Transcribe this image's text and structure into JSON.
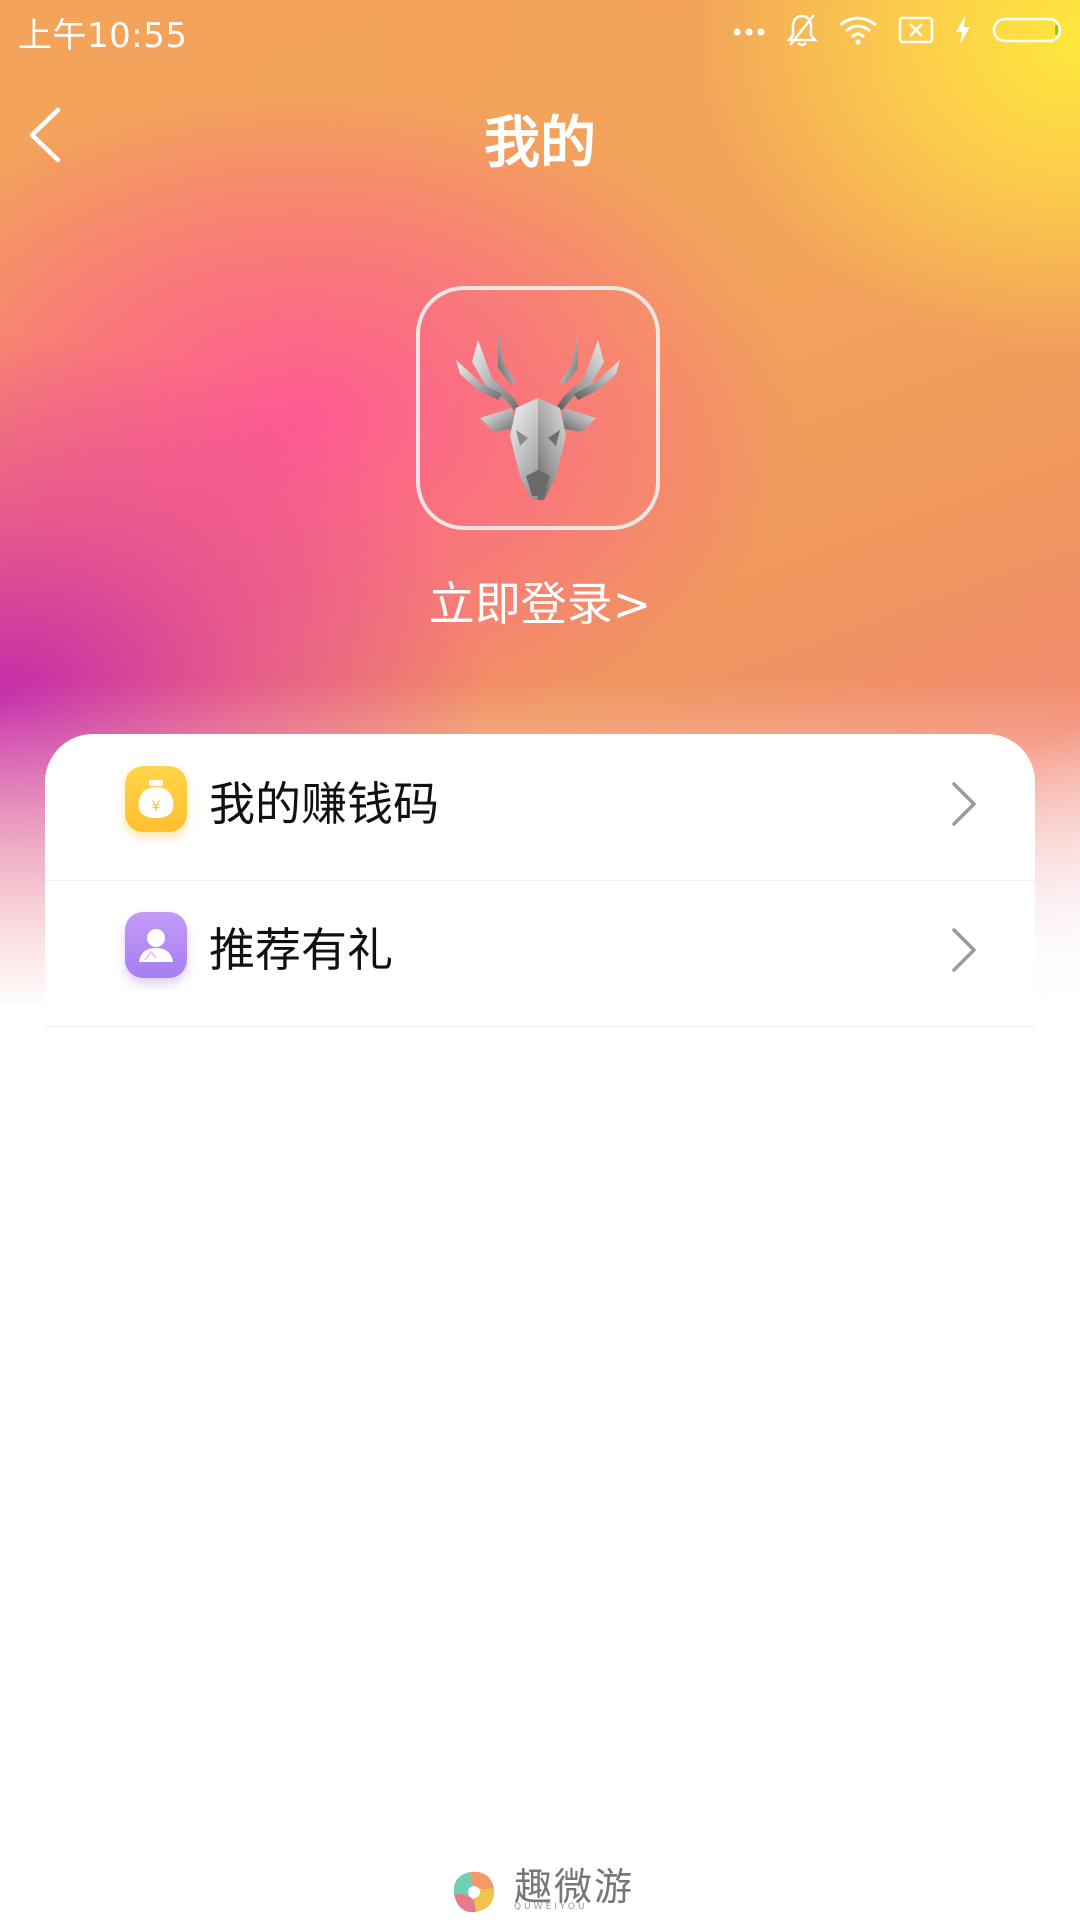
{
  "status_bar": {
    "time": "上午10:55",
    "icons": [
      "more-dots-icon",
      "bell-off-icon",
      "wifi-icon",
      "sim-x-icon",
      "charging-bolt-icon",
      "battery-icon"
    ]
  },
  "nav": {
    "title": "我的",
    "back_icon": "chevron-left-icon"
  },
  "profile": {
    "avatar_icon": "deer-head-icon",
    "login_text": "立即登录>"
  },
  "menu": {
    "items": [
      {
        "label": "我的赚钱码",
        "icon": "money-bag-icon",
        "icon_color": "#ffc83a",
        "arrow_icon": "chevron-right-icon"
      },
      {
        "label": "推荐有礼",
        "icon": "person-icon",
        "icon_color": "#b48cf4",
        "arrow_icon": "chevron-right-icon"
      }
    ]
  },
  "footer": {
    "brand_name": "趣微游",
    "brand_sub": "QUWEIYOU"
  },
  "colors": {
    "gradient_yellow": "#ffe83c",
    "gradient_orange": "#f2a35b",
    "gradient_pink": "#ff5596",
    "gradient_magenta": "#c428aa"
  }
}
